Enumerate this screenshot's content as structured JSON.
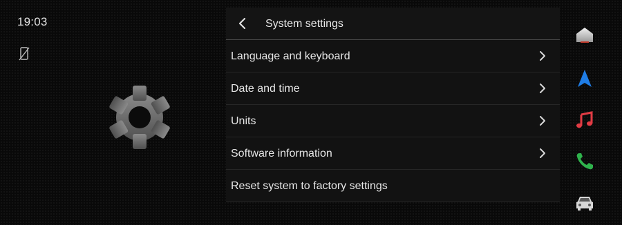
{
  "status": {
    "time": "19:03",
    "phone_icon": "phone-disconnected-icon"
  },
  "hero_icon": "gear-icon",
  "panel": {
    "back_icon": "back-chevron-icon",
    "title": "System settings",
    "items": [
      {
        "label": "Language and keyboard",
        "has_chevron": true
      },
      {
        "label": "Date and time",
        "has_chevron": true
      },
      {
        "label": "Units",
        "has_chevron": true
      },
      {
        "label": "Software information",
        "has_chevron": true
      },
      {
        "label": "Reset system to factory settings",
        "has_chevron": false
      }
    ]
  },
  "dock": [
    {
      "name": "home-icon",
      "color": "#d8d8d8"
    },
    {
      "name": "navigation-icon",
      "color": "#1f7de6"
    },
    {
      "name": "music-icon",
      "color": "#e23b44"
    },
    {
      "name": "phone-icon",
      "color": "#2fb24c"
    },
    {
      "name": "car-icon",
      "color": "#d8d8d8"
    }
  ]
}
